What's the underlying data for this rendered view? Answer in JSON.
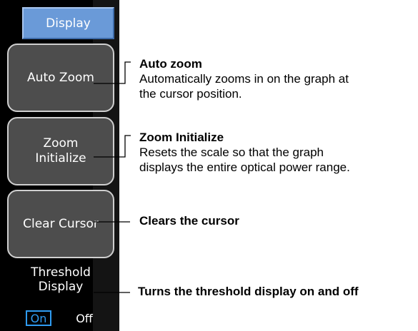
{
  "menu": {
    "header": "Display",
    "auto_zoom": "Auto Zoom",
    "zoom_initialize_line1": "Zoom",
    "zoom_initialize_line2": "Initialize",
    "clear_cursor": "Clear Cursor",
    "threshold_line1": "Threshold",
    "threshold_line2": "Display",
    "threshold_on": "On",
    "threshold_off": "Off",
    "threshold_selected": "On"
  },
  "annotations": {
    "auto_zoom_title": "Auto zoom",
    "auto_zoom_desc1": "Automatically zooms in on the graph at",
    "auto_zoom_desc2": "the cursor position.",
    "zoom_init_title": "Zoom Initialize",
    "zoom_init_desc1": "Resets the scale so that the graph",
    "zoom_init_desc2": "displays the entire optical power range.",
    "clear_cursor": "Clears the cursor",
    "threshold": "Turns the threshold display on and off"
  },
  "colors": {
    "header_blue": "#6a9ad8",
    "on_highlight": "#2f9cf2",
    "key_gray": "#4d4d4d"
  }
}
